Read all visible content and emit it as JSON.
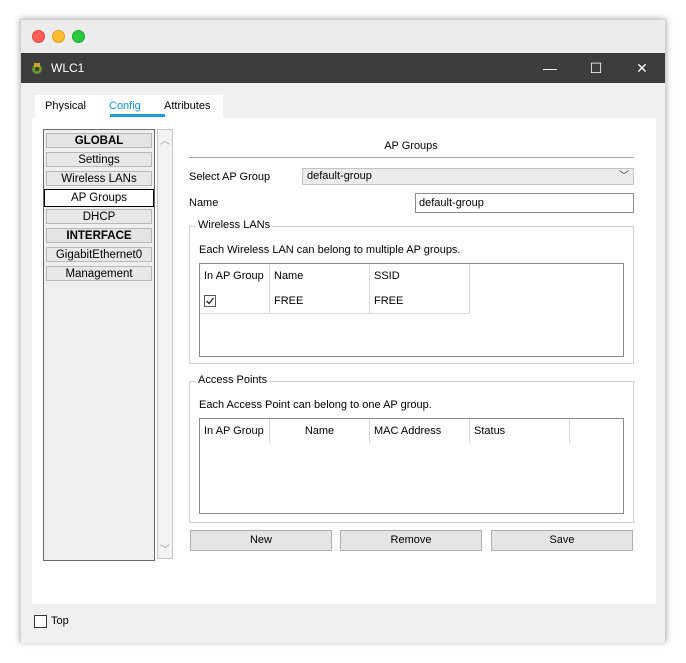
{
  "window": {
    "title": "WLC1",
    "icon": "router-icon",
    "controls": {
      "minimize": "—",
      "maximize": "☐",
      "close": "✕"
    }
  },
  "tabs": [
    {
      "label": "Physical"
    },
    {
      "label": "Config",
      "active": true
    },
    {
      "label": "Attributes"
    }
  ],
  "sidebar": {
    "items": [
      {
        "label": "GLOBAL",
        "header": true
      },
      {
        "label": "Settings"
      },
      {
        "label": "Wireless LANs"
      },
      {
        "label": "AP Groups",
        "selected": true
      },
      {
        "label": "DHCP"
      },
      {
        "label": "INTERFACE",
        "header": true
      },
      {
        "label": "GigabitEthernet0"
      },
      {
        "label": "Management"
      }
    ]
  },
  "main": {
    "section_title": "AP Groups",
    "select_label": "Select AP Group",
    "select_value": "default-group",
    "name_label": "Name",
    "name_value": "default-group",
    "wireless_lans": {
      "legend": "Wireless LANs",
      "description": "Each Wireless LAN can belong to multiple AP groups.",
      "columns": [
        "In AP Group",
        "Name",
        "SSID"
      ],
      "rows": [
        {
          "checked": true,
          "name": "FREE",
          "ssid": "FREE"
        }
      ]
    },
    "access_points": {
      "legend": "Access Points",
      "description": "Each Access Point can belong to one AP group.",
      "columns": [
        "In AP Group",
        "Name",
        "MAC Address",
        "Status"
      ]
    },
    "buttons": {
      "new": "New",
      "remove": "Remove",
      "save": "Save"
    }
  },
  "footer": {
    "top_label": "Top",
    "top_checked": false
  },
  "colors": {
    "accent": "#1a9cd8",
    "titlebar": "#3c3c3c"
  }
}
